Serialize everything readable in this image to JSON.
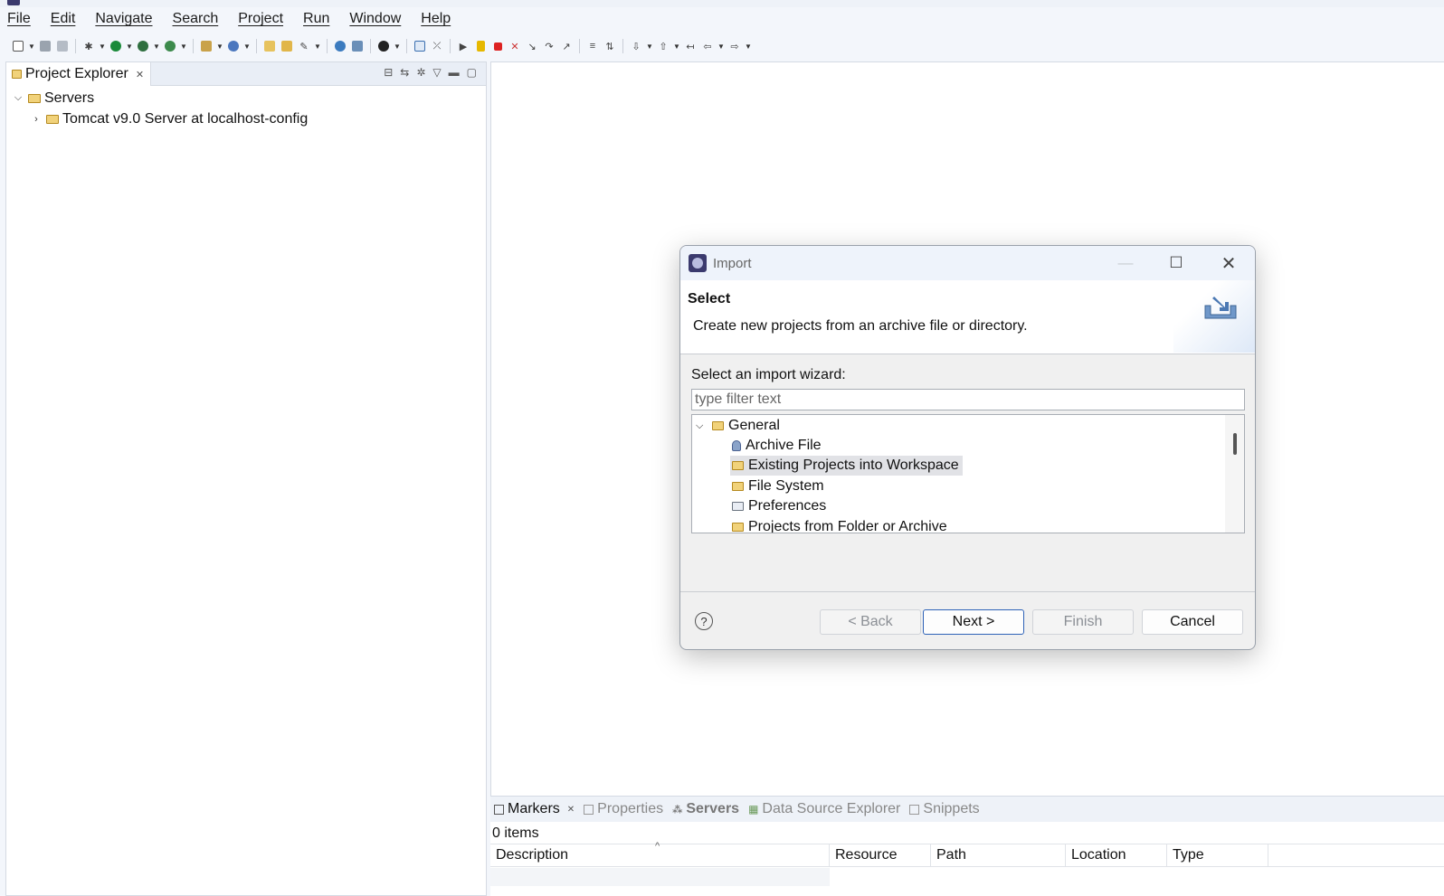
{
  "menu": [
    "File",
    "Edit",
    "Navigate",
    "Search",
    "Project",
    "Run",
    "Window",
    "Help"
  ],
  "project_explorer": {
    "tab_label": "Project Explorer",
    "tree": [
      {
        "label": "Servers",
        "expanded": true
      },
      {
        "label": "Tomcat v9.0 Server at localhost-config",
        "expanded": false
      }
    ]
  },
  "bottom_panel": {
    "tabs": [
      "Markers",
      "Properties",
      "Servers",
      "Data Source Explorer",
      "Snippets"
    ],
    "items_count": "0 items",
    "columns": [
      "Description",
      "Resource",
      "Path",
      "Location",
      "Type"
    ]
  },
  "dialog": {
    "title": "Import",
    "header_title": "Select",
    "header_desc": "Create new projects from an archive file or directory.",
    "wizard_label": "Select an import wizard:",
    "filter_placeholder": "type filter text",
    "tree": {
      "group": "General",
      "items": [
        "Archive File",
        "Existing Projects into Workspace",
        "File System",
        "Preferences",
        "Projects from Folder or Archive"
      ],
      "selected": "Existing Projects into Workspace"
    },
    "buttons": {
      "back": "< Back",
      "next": "Next >",
      "finish": "Finish",
      "cancel": "Cancel"
    },
    "help_glyph": "?"
  },
  "colors": {
    "accent": "#2e62b7",
    "selection": "#e1e2e6"
  }
}
